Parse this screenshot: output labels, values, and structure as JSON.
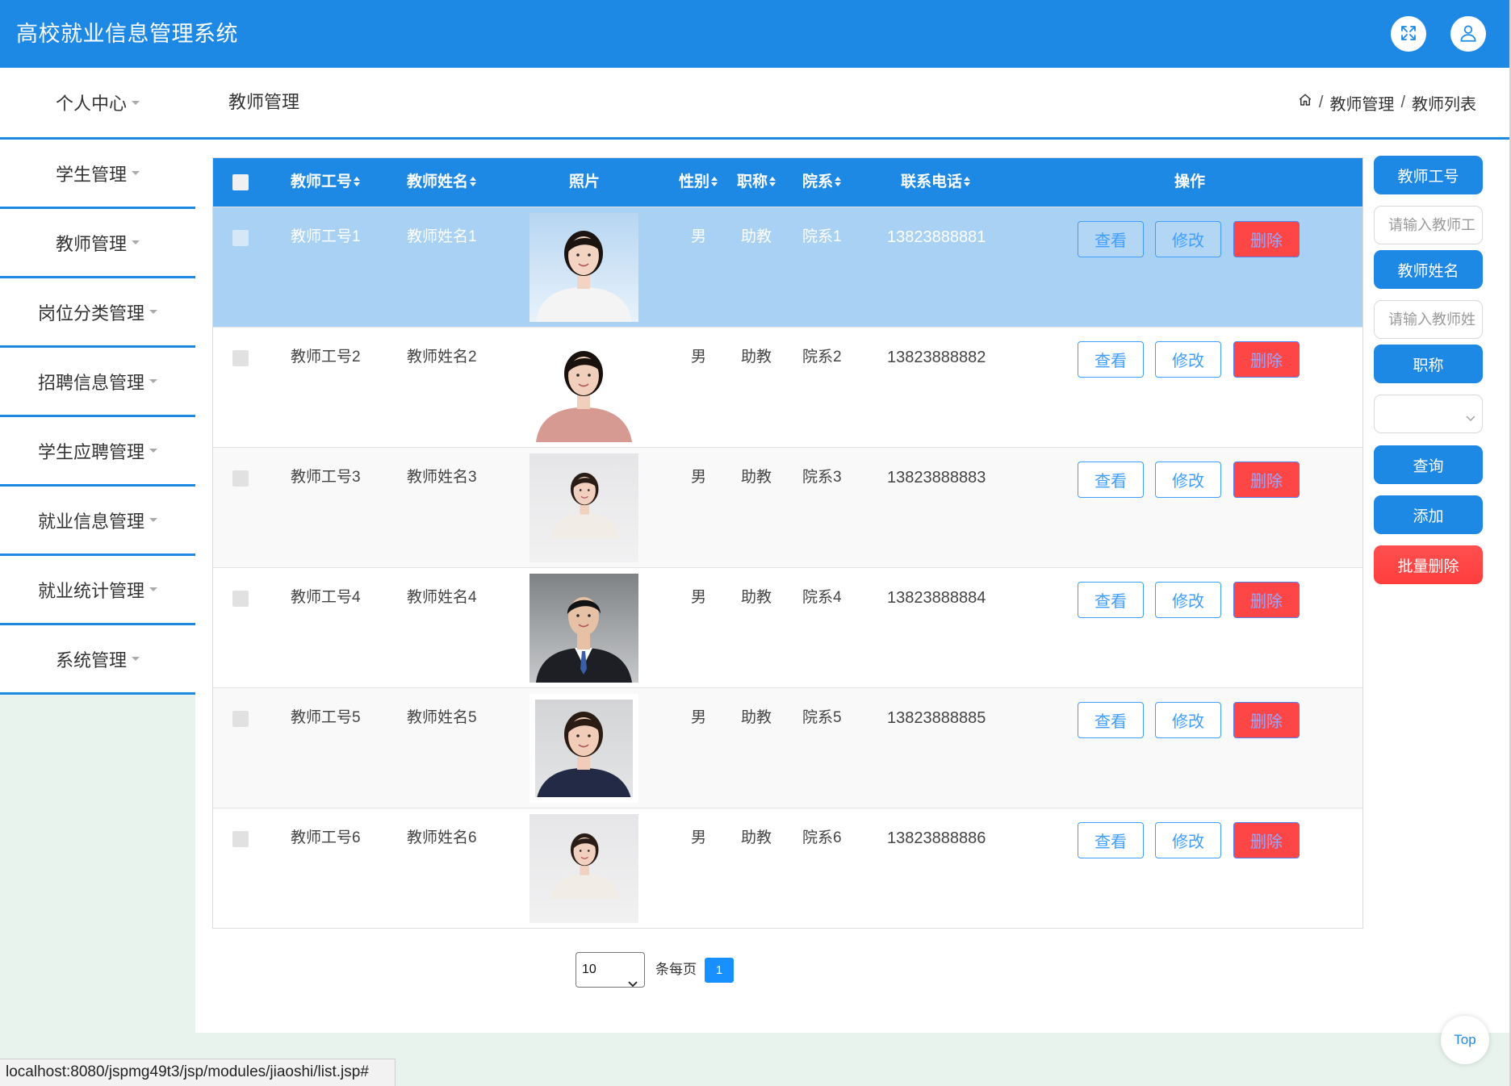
{
  "app": {
    "title": "高校就业信息管理系统",
    "colors": {
      "primary": "#1e88e5",
      "danger": "#ff4646",
      "row_highlight": "#a9d1f4",
      "page_bg": "#e8f3ed"
    }
  },
  "header": {
    "fullscreen_icon": "fullscreen-icon",
    "user_icon": "user-icon"
  },
  "topbar": {
    "page_title": "教师管理",
    "home_icon": "home-icon",
    "separator": "/",
    "breadcrumb": [
      "教师管理",
      "教师列表"
    ]
  },
  "sidebar": {
    "items": [
      {
        "label": "个人中心"
      },
      {
        "label": "学生管理"
      },
      {
        "label": "教师管理"
      },
      {
        "label": "岗位分类管理"
      },
      {
        "label": "招聘信息管理"
      },
      {
        "label": "学生应聘管理"
      },
      {
        "label": "就业信息管理"
      },
      {
        "label": "就业统计管理"
      },
      {
        "label": "系统管理"
      }
    ]
  },
  "table": {
    "columns": {
      "id": "教师工号",
      "name": "教师姓名",
      "photo": "照片",
      "gender": "性别",
      "title": "职称",
      "dept": "院系",
      "phone": "联系电话",
      "actions": "操作"
    },
    "actions": {
      "view": "查看",
      "edit": "修改",
      "delete": "删除"
    },
    "rows": [
      {
        "id": "教师工号1",
        "name": "教师姓名1",
        "gender": "男",
        "title": "助教",
        "dept": "院系1",
        "phone": "13823888881"
      },
      {
        "id": "教师工号2",
        "name": "教师姓名2",
        "gender": "男",
        "title": "助教",
        "dept": "院系2",
        "phone": "13823888882"
      },
      {
        "id": "教师工号3",
        "name": "教师姓名3",
        "gender": "男",
        "title": "助教",
        "dept": "院系3",
        "phone": "13823888883"
      },
      {
        "id": "教师工号4",
        "name": "教师姓名4",
        "gender": "男",
        "title": "助教",
        "dept": "院系4",
        "phone": "13823888884"
      },
      {
        "id": "教师工号5",
        "name": "教师姓名5",
        "gender": "男",
        "title": "助教",
        "dept": "院系5",
        "phone": "13823888885"
      },
      {
        "id": "教师工号6",
        "name": "教师姓名6",
        "gender": "男",
        "title": "助教",
        "dept": "院系6",
        "phone": "13823888886"
      }
    ]
  },
  "search": {
    "id_label": "教师工号",
    "id_placeholder": "请输入教师工号",
    "name_label": "教师姓名",
    "name_placeholder": "请输入教师姓名",
    "title_label": "职称",
    "query_button": "查询",
    "add_button": "添加",
    "batch_delete_button": "批量删除"
  },
  "pagination": {
    "page_size": "10",
    "page_size_label": "条每页",
    "current_page": "1"
  },
  "back_to_top": "Top",
  "status_bar": "localhost:8080/jspmg49t3/jsp/modules/jiaoshi/list.jsp#"
}
